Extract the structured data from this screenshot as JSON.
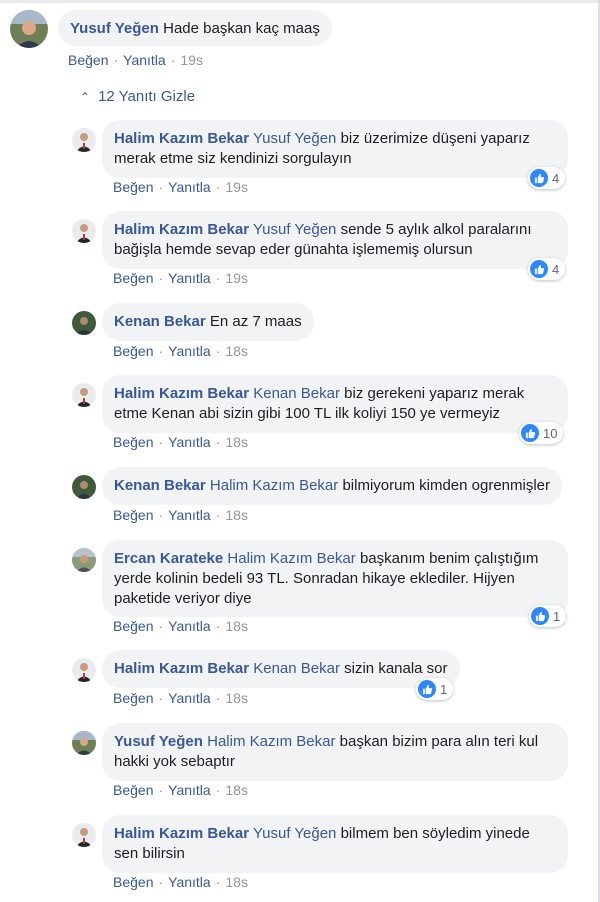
{
  "colors": {
    "link": "#385898",
    "bubble": "#f2f3f5",
    "meta": "#90949c",
    "like": "#2d88ff"
  },
  "top_comment": {
    "author": "Yusuf Yeğen",
    "text": "Hade başkan kaç maaş",
    "like": "Beğen",
    "reply": "Yanıtla",
    "time": "19s"
  },
  "replies_toggle": {
    "icon": "chevron-up-icon",
    "label": "12 Yanıtı Gizle"
  },
  "replies": [
    {
      "author": "Halim Kazım Bekar",
      "mention": "Yusuf Yeğen",
      "line1": "biz üzerimize düşeni yaparız",
      "line2": "merak etme siz kendinizi sorgulayın",
      "line3": "",
      "like": "Beğen",
      "reply": "Yanıtla",
      "time": "19s",
      "reactions": "4"
    },
    {
      "author": "Halim Kazım Bekar",
      "mention": "Yusuf Yeğen",
      "line1": "sende 5 aylık alkol paralarını",
      "line2": "bağişla hemde sevap eder günahta işlememiş olursun",
      "line3": "",
      "like": "Beğen",
      "reply": "Yanıtla",
      "time": "19s",
      "reactions": "4"
    },
    {
      "author": "Kenan Bekar",
      "mention": "",
      "line1": "En az 7 maas",
      "line2": "",
      "line3": "",
      "like": "Beğen",
      "reply": "Yanıtla",
      "time": "18s",
      "reactions": ""
    },
    {
      "author": "Halim Kazım Bekar",
      "mention": "Kenan Bekar",
      "line1": "biz gerekeni yaparız merak",
      "line2": "etme Kenan abi sizin gibi 100 TL ilk koliyi 150 ye vermeyiz",
      "line3": "",
      "like": "Beğen",
      "reply": "Yanıtla",
      "time": "18s",
      "reactions": "10"
    },
    {
      "author": "Kenan Bekar",
      "mention": "Halim Kazım Bekar",
      "line1": "bilmiyorum kimden ogrenmişler",
      "line2": "",
      "line3": "",
      "like": "Beğen",
      "reply": "Yanıtla",
      "time": "18s",
      "reactions": ""
    },
    {
      "author": "Ercan Karateke",
      "mention": "Halim Kazım Bekar",
      "line1": "başkanım benim çalıştığım",
      "line2": "yerde kolinin bedeli 93 TL. Sonradan hikaye eklediler. Hijyen",
      "line3": "paketide veriyor diye",
      "like": "Beğen",
      "reply": "Yanıtla",
      "time": "18s",
      "reactions": "1"
    },
    {
      "author": "Halim Kazım Bekar",
      "mention": "Kenan Bekar",
      "line1": "sizin kanala sor",
      "line2": "",
      "line3": "",
      "like": "Beğen",
      "reply": "Yanıtla",
      "time": "18s",
      "reactions": "1"
    },
    {
      "author": "Yusuf Yeğen",
      "mention": "Halim Kazım Bekar",
      "line1": "başkan bizim para alın teri kul",
      "line2": "hakki yok sebaptır",
      "line3": "",
      "like": "Beğen",
      "reply": "Yanıtla",
      "time": "18s",
      "reactions": ""
    },
    {
      "author": "Halim Kazım Bekar",
      "mention": "Yusuf Yeğen",
      "line1": "bilmem ben söyledim yinede",
      "line2": "sen bilirsin",
      "line3": "",
      "like": "Beğen",
      "reply": "Yanıtla",
      "time": "18s",
      "reactions": ""
    }
  ]
}
